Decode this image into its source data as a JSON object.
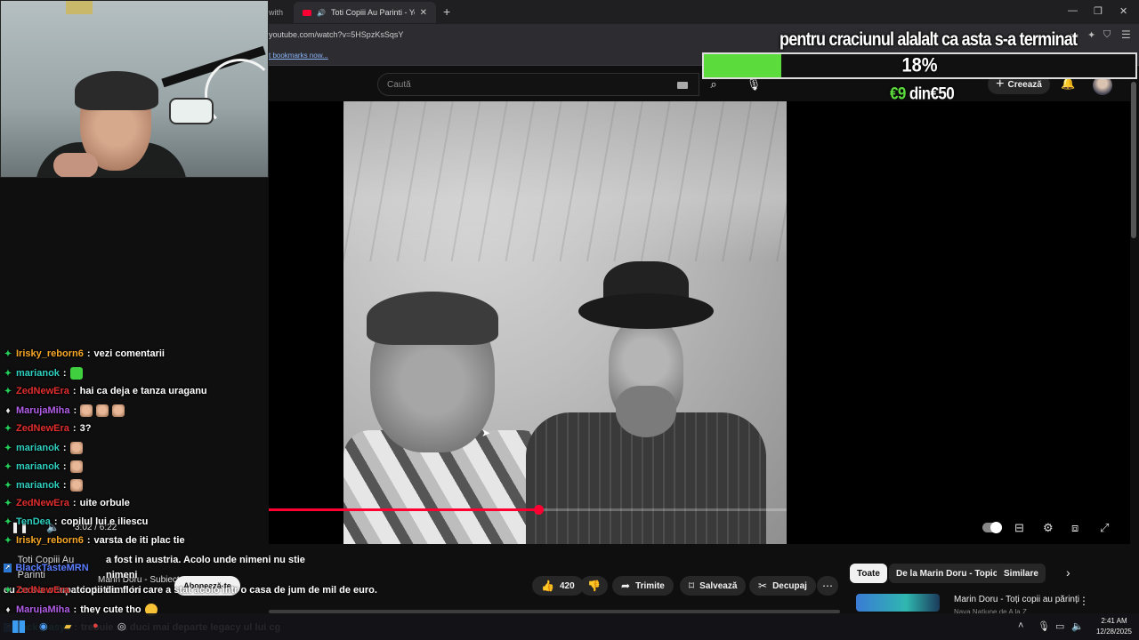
{
  "browser": {
    "prev_tab_label": "with",
    "active_tab_title": "Toti Copiii Au Parinti - YouTube",
    "url": "youtube.com/watch?v=5HSpzKsSqsY",
    "bookmarks_hint": "t bookmarks now..."
  },
  "youtube": {
    "search_placeholder": "Caută",
    "create_label": "Creează",
    "timecode": "3:02 / 6:22",
    "progress_fraction": 0.52,
    "channel_name": "Marin Doru - Subiect",
    "channel_subs": "",
    "subscribe_label": "Abonează-te",
    "likes": "420",
    "share_label": "Trimite",
    "save_label": "Salvează",
    "clip_label": "Decupaj",
    "chips": [
      "Toate",
      "De la Marin Doru - Topic",
      "Similare"
    ],
    "rec_title": "Marin Doru - Toți copii au părinți",
    "rec_sub": "Nava Natiune de A la Z"
  },
  "donation": {
    "goal_text": "pentru craciunul alalalt ca asta s-a terminat",
    "percent_label": "18%",
    "percent": 0.18,
    "raised": "€9",
    "of_word": "din",
    "goal": "€50",
    "fill_color": "#5cdb3c"
  },
  "chat": [
    {
      "user": "Irisky_reborn6",
      "color": "#f7a828",
      "badge": "k",
      "msg": "vezi comentarii",
      "emotes": []
    },
    {
      "user": "marianok",
      "color": "#2fd0c0",
      "badge": "k",
      "msg": "",
      "emotes": [
        "green"
      ]
    },
    {
      "user": "ZedNewEra",
      "color": "#e02e2e",
      "badge": "k",
      "msg": "hai ca deja e tanza uraganu",
      "emotes": []
    },
    {
      "user": "MarujaMiha",
      "color": "#b25ee8",
      "badge": "vip",
      "msg": "",
      "emotes": [
        "face",
        "face",
        "face"
      ]
    },
    {
      "user": "ZedNewEra",
      "color": "#e02e2e",
      "badge": "k",
      "msg": "3?",
      "emotes": []
    },
    {
      "user": "marianok",
      "color": "#2fd0c0",
      "badge": "k",
      "msg": "",
      "emotes": [
        "face"
      ]
    },
    {
      "user": "marianok",
      "color": "#2fd0c0",
      "badge": "k",
      "msg": "",
      "emotes": [
        "face"
      ]
    },
    {
      "user": "marianok",
      "color": "#2fd0c0",
      "badge": "k",
      "msg": "",
      "emotes": [
        "face"
      ]
    },
    {
      "user": "ZedNewEra",
      "color": "#e02e2e",
      "badge": "k",
      "msg": "uite orbule",
      "emotes": []
    },
    {
      "user": "TenDea",
      "color": "#2fd0c0",
      "badge": "k",
      "msg": "copilul lui e iliescu",
      "emotes": []
    },
    {
      "user": "Irisky_reborn6",
      "color": "#f7a828",
      "badge": "k",
      "msg": "varsta de iti plac tie",
      "emotes": []
    }
  ],
  "chat_long": {
    "user": "BlackTasteMRN",
    "color": "#5a7cff",
    "line1": "a fost in austria. Acolo unde nimeni nu stie nimeni",
    "line2": "cu ce s a ocupat in toti anii in care a stat acolo intr o casa de jum de mil de euro."
  },
  "chat_tail": [
    {
      "user": "ZedNewEra",
      "color": "#e02e2e",
      "badge": "k",
      "msg": "copii din flori",
      "emotes": []
    },
    {
      "user": "MarujaMiha",
      "color": "#b25ee8",
      "badge": "vip",
      "msg": "they cute tho",
      "emotes": [
        "yellow"
      ]
    },
    {
      "user": "Jack_easy3",
      "color": "#2fd0c0",
      "badge": "box",
      "msg": "trebuie sa duci mai departe legacy ul lui cg",
      "emotes": []
    }
  ],
  "video_overlay_title": "Toti Copiii Au Parinti",
  "taskbar": {
    "time": "2:41 AM",
    "date": "12/28/2025"
  }
}
